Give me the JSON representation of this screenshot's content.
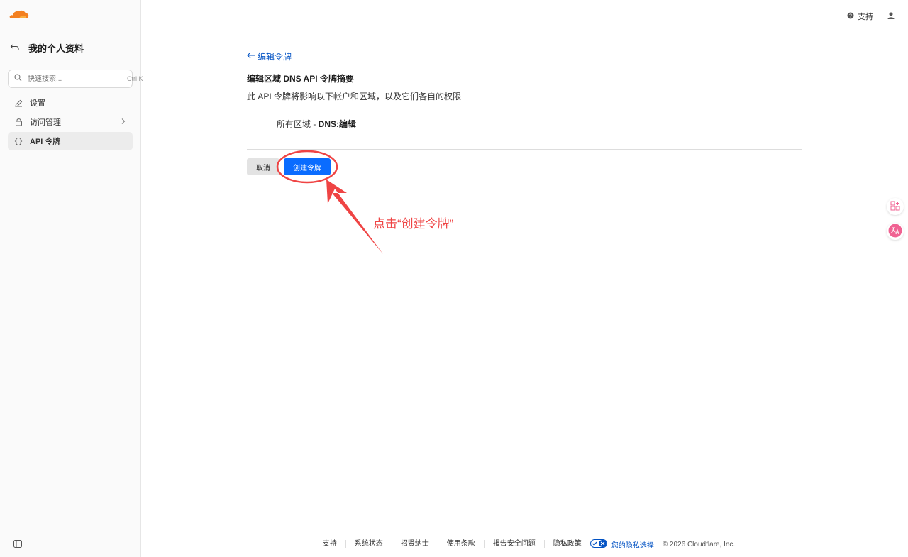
{
  "sidebar": {
    "title": "我的个人资料",
    "search": {
      "placeholder": "快速搜索...",
      "shortcut": "Ctrl K"
    },
    "items": [
      {
        "label": "设置",
        "icon": "pencil-icon"
      },
      {
        "label": "访问管理",
        "icon": "lock-icon"
      },
      {
        "label": "API 令牌",
        "icon": "braces-icon"
      }
    ]
  },
  "topbar": {
    "support": "支持"
  },
  "main": {
    "back_link": "编辑令牌",
    "summary_title": "编辑区域 DNS API 令牌摘要",
    "summary_desc": "此 API 令牌将影响以下帐户和区域，以及它们各自的权限",
    "permission_scope": "所有区域 - ",
    "permission_value": "DNS:编辑",
    "cancel_label": "取消",
    "create_label": "创建令牌"
  },
  "annotation": {
    "text": "点击“创建令牌”",
    "color": "#ef4444"
  },
  "footer": {
    "links": [
      "支持",
      "系统状态",
      "招贤纳士",
      "使用条款",
      "报告安全问题",
      "隐私政策"
    ],
    "privacy_choice": "您的隐私选择",
    "copyright": "© 2026 Cloudflare, Inc."
  },
  "colors": {
    "accent": "#0a6cff",
    "link": "#0051c3",
    "brand": "#f38020"
  }
}
